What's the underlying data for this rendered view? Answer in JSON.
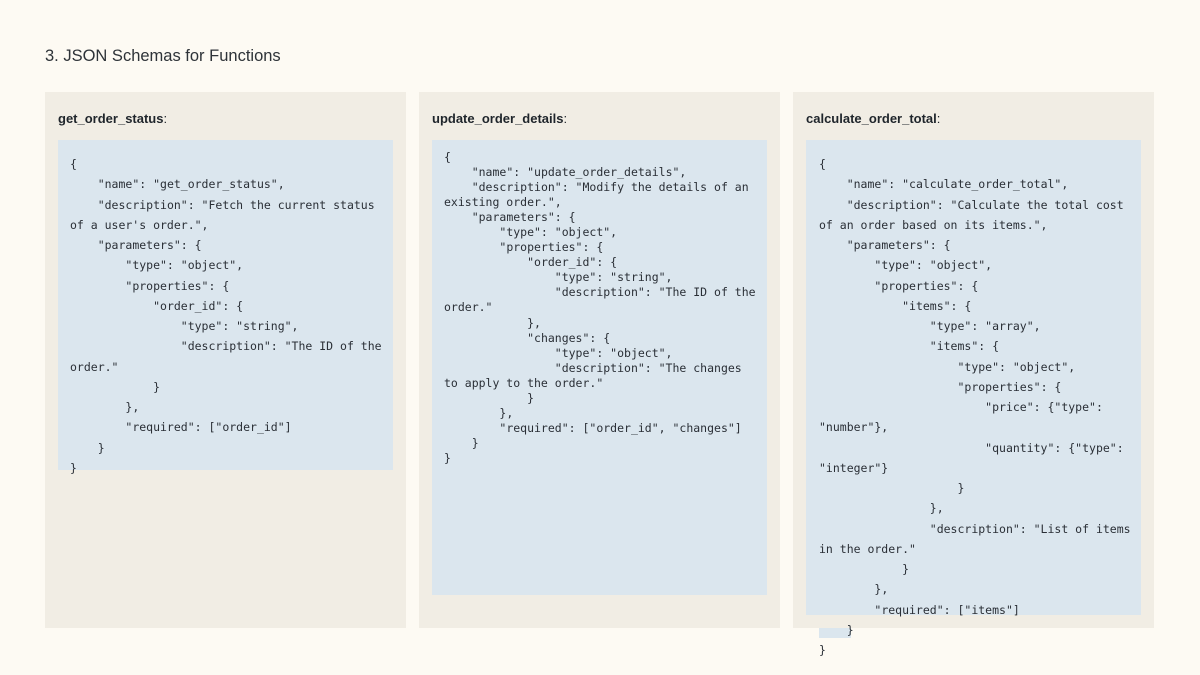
{
  "page": {
    "title": "3. JSON Schemas for Functions"
  },
  "cards": [
    {
      "function_name": "get_order_status",
      "suffix": ":",
      "schema": "{\n    \"name\": \"get_order_status\",\n    \"description\": \"Fetch the current status of a user's order.\",\n    \"parameters\": {\n        \"type\": \"object\",\n        \"properties\": {\n            \"order_id\": {\n                \"type\": \"string\",\n                \"description\": \"The ID of the order.\"\n            }\n        },\n        \"required\": [\"order_id\"]\n    }\n}"
    },
    {
      "function_name": "update_order_details",
      "suffix": ":",
      "schema": "{\n    \"name\": \"update_order_details\",\n    \"description\": \"Modify the details of an existing order.\",\n    \"parameters\": {\n        \"type\": \"object\",\n        \"properties\": {\n            \"order_id\": {\n                \"type\": \"string\",\n                \"description\": \"The ID of the order.\"\n            },\n            \"changes\": {\n                \"type\": \"object\",\n                \"description\": \"The changes to apply to the order.\"\n            }\n        },\n        \"required\": [\"order_id\", \"changes\"]\n    }\n}"
    },
    {
      "function_name": "calculate_order_total",
      "suffix": ":",
      "schema": "{\n    \"name\": \"calculate_order_total\",\n    \"description\": \"Calculate the total cost of an order based on its items.\",\n    \"parameters\": {\n        \"type\": \"object\",\n        \"properties\": {\n            \"items\": {\n                \"type\": \"array\",\n                \"items\": {\n                    \"type\": \"object\",\n                    \"properties\": {\n                        \"price\": {\"type\": \"number\"},\n                        \"quantity\": {\"type\": \"integer\"}\n                    }\n                },\n                \"description\": \"List of items in the order.\"\n            }\n        },\n        \"required\": [\"items\"]\n    }\n}"
    }
  ]
}
